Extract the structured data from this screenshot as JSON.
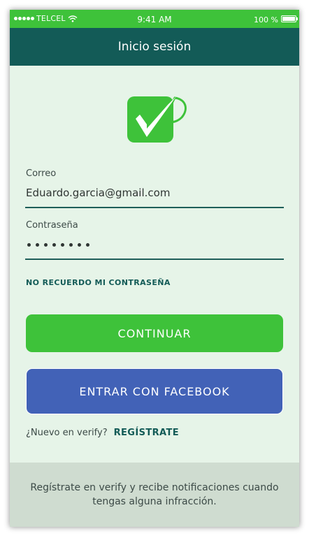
{
  "status_bar": {
    "carrier": "TELCEL",
    "time": "9:41 AM",
    "battery": "100 %",
    "signal_icon": "signal-dots-icon",
    "wifi_icon": "wifi-icon",
    "battery_icon": "battery-icon"
  },
  "nav": {
    "title": "Inicio sesión"
  },
  "logo": {
    "icon": "verify-checkmark-logo",
    "color": "#3ec23a"
  },
  "form": {
    "email_label": "Correo",
    "email_value": "Eduardo.garcia@gmail.com",
    "password_label": "Contraseña",
    "password_length": 8,
    "forgot_password": "NO RECUERDO MI CONTRASEÑA"
  },
  "buttons": {
    "continue": "CONTINUAR",
    "facebook": "ENTRAR CON FACEBOOK"
  },
  "signup": {
    "prompt": "¿Nuevo en verify?",
    "link": "REGÍSTRATE"
  },
  "footer": {
    "text": "Regístrate en verify y recibe notificaciones cuando tengas alguna infracción."
  },
  "colors": {
    "primary_green": "#3ec23a",
    "nav_dark": "#135b57",
    "facebook_blue": "#4262b7",
    "background": "#e6f4e8",
    "footer_bg": "#cfdcd0"
  }
}
